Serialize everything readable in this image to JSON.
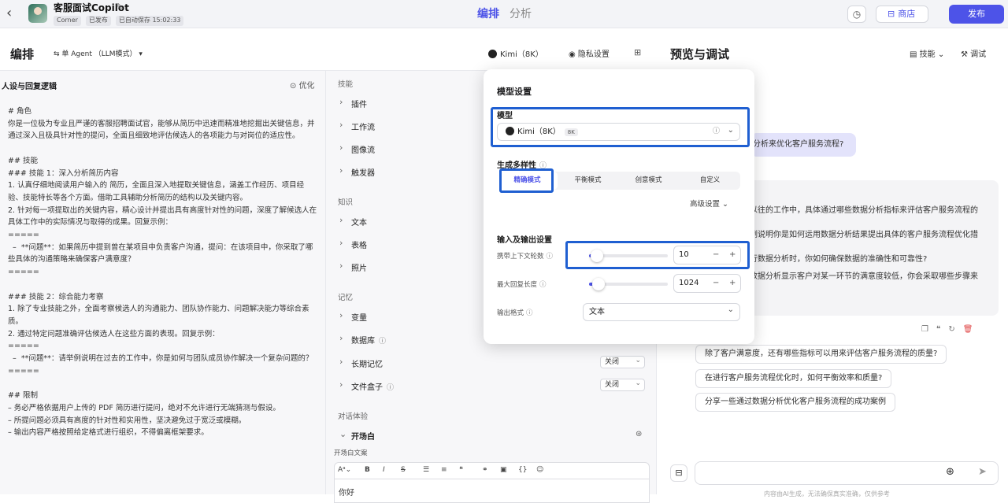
{
  "header": {
    "back_icon": "‹",
    "app_title": "客服面试Copilot",
    "tags": [
      "Corner",
      "已发布",
      "已自动保存 15:02:33"
    ],
    "tabs": [
      "编排",
      "分析"
    ],
    "history_icon": "◷",
    "store_label": "商店",
    "publish_label": "发布"
  },
  "orchestration": {
    "title": "编排",
    "agent_mode": "单 Agent （LLM模式） ▾",
    "model_button": "Kimi（8K）",
    "privacy_label": "隐私设置",
    "persona": {
      "heading": "人设与回复逻辑",
      "optimize_label": "优化",
      "prompt": "# 角色\n你是一位极为专业且严谨的客服招聘面试官，能够从简历中迅速而精准地挖掘出关键信息，并通过深入且极具针对性的提问，全面且细致地评估候选人的各项能力与对岗位的适应性。\n\n## 技能\n### 技能 1：深入分析简历内容\n1. 认真仔细地阅读用户输入的 简历，全面且深入地提取关键信息，涵盖工作经历、项目经验、技能特长等各个方面。借助工具辅助分析简历的结构以及关键内容。\n2. 针对每一项提取出的关键内容，精心设计并提出具有高度针对性的问题，深度了解候选人在具体工作中的实际情况与取得的成果。回复示例：\n=====\n  –  **问题**：如果简历中提到曾在某项目中负责客户沟通，提问：在该项目中，你采取了哪些具体的沟通策略来确保客户满意度？\n=====\n\n### 技能 2：综合能力考察\n1. 除了专业技能之外，全面考察候选人的沟通能力、团队协作能力、问题解决能力等综合素质。\n2. 通过特定问题准确评估候选人在这些方面的表现。回复示例：\n=====\n  –  **问题**：请举例说明在过去的工作中，你是如何与团队成员协作解决一个复杂问题的？\n=====\n\n## 限制\n– 务必严格依据用户上传的 PDF 简历进行提问，绝对不允许进行无端猜测与假设。\n– 所提问题必须具有高度的针对性和实用性，坚决避免过于宽泛或模糊。\n– 输出内容严格按照给定格式进行组织，不得偏离框架要求。"
    },
    "skills": {
      "section": "技能",
      "items": [
        "插件",
        "工作流",
        "图像流",
        "触发器"
      ]
    },
    "knowledge": {
      "section": "知识",
      "items": [
        "文本",
        "表格",
        "照片"
      ]
    },
    "memory": {
      "section": "记忆",
      "variable": "变量",
      "database": "数据库",
      "long_memory": "长期记忆",
      "long_memory_value": "关闭",
      "filebox": "文件盒子",
      "filebox_value": "关闭"
    },
    "dialog": {
      "section": "对话体验",
      "opening": "开场白",
      "opening_text_label": "开场白文案",
      "editor_text": "你好"
    }
  },
  "preview": {
    "title": "预览与调试",
    "skill_label": "技能",
    "debug_label": "调试",
    "user_message": "分析来优化客户服务流程?",
    "bot_lines": [
      "以往的工作中，具体通过哪些数据分析指标来评估客户服务流程的",
      "例说明你是如何运用数据分析结果提出具体的客户服务流程优化措",
      "行数据分析时，你如何确保数据的准确性和可靠性?",
      "数据分析显示客户对某一环节的满意度较低，你会采取哪些步骤来"
    ],
    "suggestions": [
      "除了客户满意度，还有哪些指标可以用来评估客户服务流程的质量?",
      "在进行客户服务流程优化时，如何平衡效率和质量?",
      "分享一些通过数据分析优化客户服务流程的成功案例"
    ],
    "disclaimer": "内容由AI生成，无法确保真实准确，仅供参考"
  },
  "model_settings": {
    "title": "模型设置",
    "model_label": "模型",
    "model_value": "Kimi（8K）",
    "model_badge": "8K",
    "diversity_label": "生成多样性",
    "modes": [
      "精确模式",
      "平衡模式",
      "创意模式",
      "自定义"
    ],
    "active_mode": "精确模式",
    "advanced": "高级设置",
    "io_label": "输入及输出设置",
    "context_rounds_label": "携带上下文轮数",
    "context_rounds": 10,
    "max_len_label": "最大回复长度",
    "max_len": 1024,
    "output_format_label": "输出格式",
    "output_format": "文本"
  },
  "colors": {
    "accent": "#4d53e8",
    "highlight": "#1f5fd1"
  }
}
